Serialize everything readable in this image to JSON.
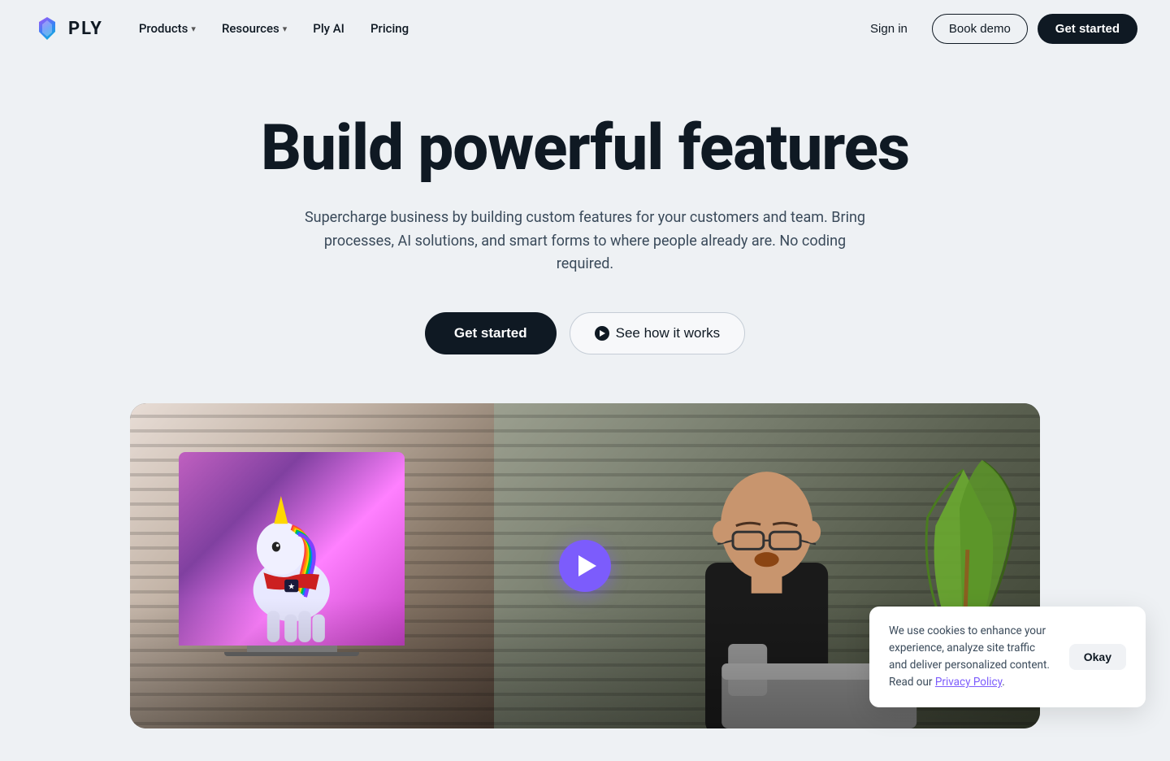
{
  "logo": {
    "text": "PLY",
    "icon_name": "ply-logo-icon"
  },
  "nav": {
    "links": [
      {
        "label": "Products",
        "has_chevron": true,
        "name": "products-nav"
      },
      {
        "label": "Resources",
        "has_chevron": true,
        "name": "resources-nav"
      },
      {
        "label": "Ply AI",
        "has_chevron": false,
        "name": "ply-ai-nav"
      },
      {
        "label": "Pricing",
        "has_chevron": false,
        "name": "pricing-nav"
      }
    ],
    "sign_in": "Sign in",
    "book_demo": "Book demo",
    "get_started": "Get started"
  },
  "hero": {
    "title": "Build powerful features",
    "subtitle": "Supercharge business by building custom features for your customers and team. Bring processes, AI solutions, and smart forms to where people already are. No coding required.",
    "cta_primary": "Get started",
    "cta_secondary": "See how it works"
  },
  "cookie": {
    "text": "We use cookies to enhance your experience, analyze site traffic and deliver personalized content. Read our ",
    "link_text": "Privacy Policy",
    "link_suffix": ".",
    "okay_label": "Okay"
  },
  "colors": {
    "dark": "#0f1923",
    "accent": "#7c5cfc",
    "background": "#eef1f4"
  }
}
